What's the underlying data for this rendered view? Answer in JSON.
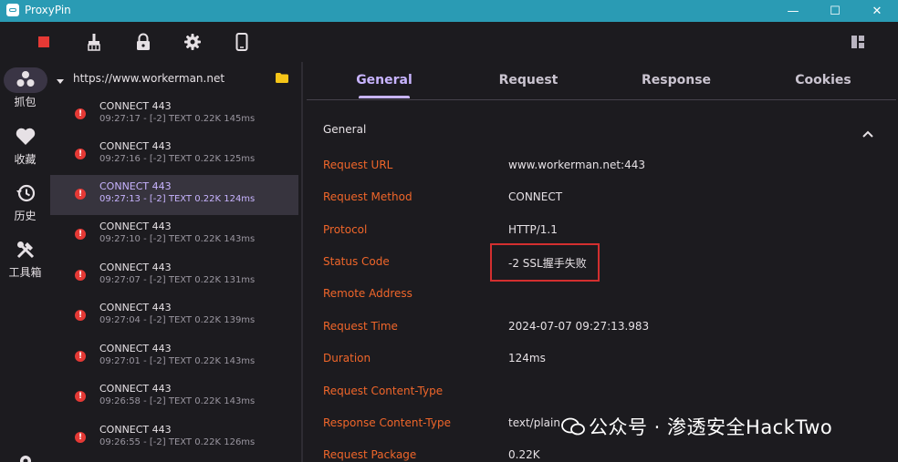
{
  "window": {
    "title": "ProxyPin",
    "minimize": "—",
    "maximize": "☐",
    "close": "✕"
  },
  "toolbar": {
    "icons": [
      "stop-icon",
      "broom-icon",
      "lock-icon",
      "gear-icon",
      "phone-icon",
      "layout-icon"
    ],
    "stop_color": "#e53935"
  },
  "rail": {
    "items": [
      {
        "label": "抓包",
        "icon": "capture-icon",
        "active": true
      },
      {
        "label": "收藏",
        "icon": "heart-icon",
        "active": false
      },
      {
        "label": "历史",
        "icon": "history-icon",
        "active": false
      },
      {
        "label": "工具箱",
        "icon": "tools-icon",
        "active": false
      }
    ]
  },
  "domain": {
    "host": "https://www.workerman.net",
    "icon": "folder-icon"
  },
  "requests": [
    {
      "method": "CONNECT 443",
      "meta": "09:27:17 - [-2]  TEXT 0.22K 145ms"
    },
    {
      "method": "CONNECT 443",
      "meta": "09:27:16 - [-2]  TEXT 0.22K 125ms"
    },
    {
      "method": "CONNECT 443",
      "meta": "09:27:13 - [-2]  TEXT 0.22K 124ms",
      "selected": true
    },
    {
      "method": "CONNECT 443",
      "meta": "09:27:10 - [-2]  TEXT 0.22K 143ms"
    },
    {
      "method": "CONNECT 443",
      "meta": "09:27:07 - [-2]  TEXT 0.22K 131ms"
    },
    {
      "method": "CONNECT 443",
      "meta": "09:27:04 - [-2]  TEXT 0.22K 139ms"
    },
    {
      "method": "CONNECT 443",
      "meta": "09:27:01 - [-2]  TEXT 0.22K 143ms"
    },
    {
      "method": "CONNECT 443",
      "meta": "09:26:58 - [-2]  TEXT 0.22K 143ms"
    },
    {
      "method": "CONNECT 443",
      "meta": "09:26:55 - [-2]  TEXT 0.22K 126ms"
    }
  ],
  "tabs": [
    "General",
    "Request",
    "Response",
    "Cookies"
  ],
  "active_tab": "General",
  "general": {
    "section_title": "General",
    "fields": [
      {
        "label": "Request URL",
        "value": "www.workerman.net:443"
      },
      {
        "label": "Request Method",
        "value": "CONNECT"
      },
      {
        "label": "Protocol",
        "value": "HTTP/1.1"
      },
      {
        "label": "Status Code",
        "value": "-2  SSL握手失败"
      },
      {
        "label": "Remote Address",
        "value": ""
      },
      {
        "label": "Request Time",
        "value": "2024-07-07 09:27:13.983"
      },
      {
        "label": "Duration",
        "value": "124ms"
      },
      {
        "label": "Request Content-Type",
        "value": ""
      },
      {
        "label": "Response Content-Type",
        "value": "text/plain"
      },
      {
        "label": "Request Package",
        "value": "0.22K"
      }
    ]
  },
  "watermark": "公众号 · 渗透安全HackTwo",
  "colors": {
    "titlebar": "#2a9bb4",
    "accent": "#c8b4ff",
    "field_label": "#f0662a",
    "error": "#e53935",
    "highlight_box": "#d32f2f"
  }
}
